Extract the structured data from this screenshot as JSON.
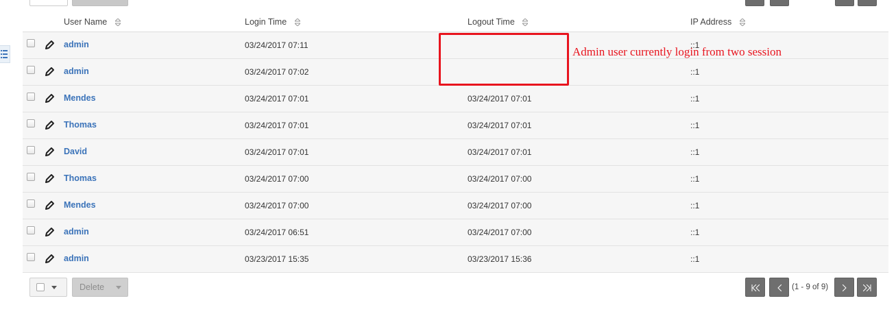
{
  "table": {
    "headers": {
      "user_name": "User Name",
      "login_time": "Login Time",
      "logout_time": "Logout Time",
      "ip_address": "IP Address"
    },
    "rows": [
      {
        "user": "admin",
        "login": "03/24/2017 07:11",
        "logout": "",
        "ip": "::1"
      },
      {
        "user": "admin",
        "login": "03/24/2017 07:02",
        "logout": "",
        "ip": "::1"
      },
      {
        "user": "Mendes",
        "login": "03/24/2017 07:01",
        "logout": "03/24/2017 07:01",
        "ip": "::1"
      },
      {
        "user": "Thomas",
        "login": "03/24/2017 07:01",
        "logout": "03/24/2017 07:01",
        "ip": "::1"
      },
      {
        "user": "David",
        "login": "03/24/2017 07:01",
        "logout": "03/24/2017 07:01",
        "ip": "::1"
      },
      {
        "user": "Thomas",
        "login": "03/24/2017 07:00",
        "logout": "03/24/2017 07:00",
        "ip": "::1"
      },
      {
        "user": "Mendes",
        "login": "03/24/2017 07:00",
        "logout": "03/24/2017 07:00",
        "ip": "::1"
      },
      {
        "user": "admin",
        "login": "03/24/2017 06:51",
        "logout": "03/24/2017 07:00",
        "ip": "::1"
      },
      {
        "user": "admin",
        "login": "03/23/2017 15:35",
        "logout": "03/23/2017 15:36",
        "ip": "::1"
      }
    ]
  },
  "annotation": {
    "note": "Admin user currently login from two session",
    "color": "#e8141e"
  },
  "bottom_bar": {
    "delete_label": "Delete",
    "pagination_info": "(1 - 9 of 9)"
  },
  "icons": {
    "edit": "pencil-icon",
    "sort": "sort-arrows-icon",
    "menu": "list-menu-icon",
    "first": "first-page-icon",
    "prev": "prev-page-icon",
    "next": "next-page-icon",
    "last": "last-page-icon"
  },
  "colors": {
    "link": "#3b73b9",
    "row_bg": "#f6f6f6",
    "pager_bg": "#6f6f6f"
  }
}
